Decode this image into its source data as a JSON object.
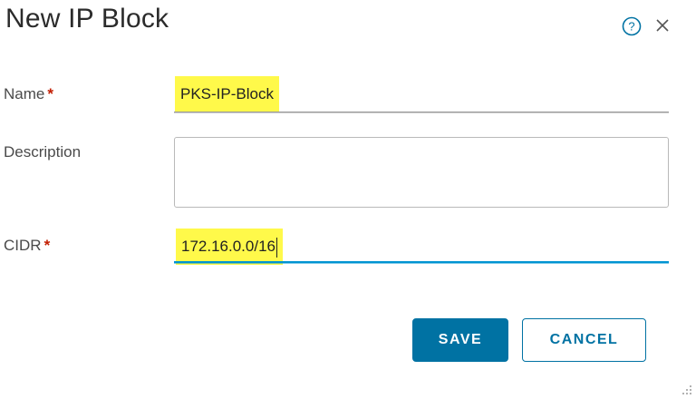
{
  "dialog": {
    "title": "New IP Block",
    "help_icon": "help-circle-icon",
    "close_icon": "close-icon"
  },
  "form": {
    "name": {
      "label": "Name",
      "required_mark": "*",
      "value": "PKS-IP-Block"
    },
    "description": {
      "label": "Description",
      "value": ""
    },
    "cidr": {
      "label": "CIDR",
      "required_mark": "*",
      "value": "172.16.0.0/16"
    }
  },
  "buttons": {
    "save_label": "SAVE",
    "cancel_label": "CANCEL"
  },
  "colors": {
    "primary": "#0072a3",
    "required": "#c21d00",
    "highlight": "#fff94a",
    "focus_underline": "#0094d2"
  }
}
